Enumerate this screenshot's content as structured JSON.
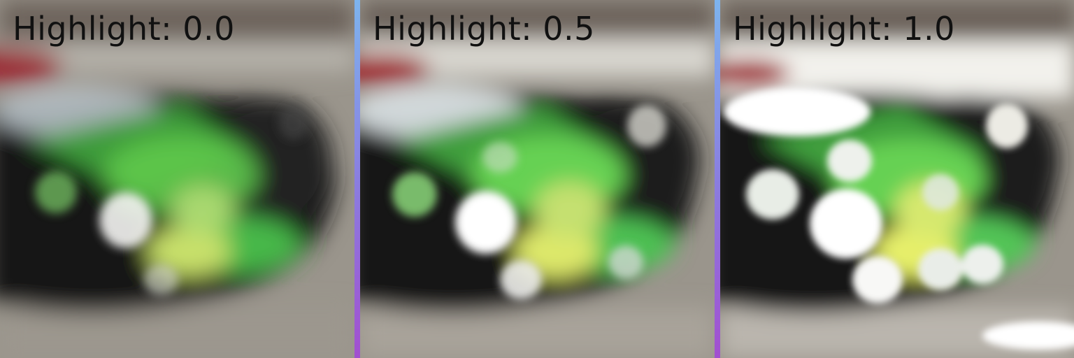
{
  "panels": [
    {
      "label": "Highlight: 0.0",
      "highlight": 0.0
    },
    {
      "label": "Highlight: 0.5",
      "highlight": 0.5
    },
    {
      "label": "Highlight: 1.0",
      "highlight": 1.0
    }
  ],
  "colors": {
    "divider_top": "#7db4ee",
    "divider_bottom": "#a24fd0",
    "label_text": "#111111",
    "background": "#8a857c",
    "shell": "#141414",
    "green_glow": "#6fd25a",
    "yellow_glow": "#e6ef6a",
    "red_accent": "#a0242c"
  }
}
